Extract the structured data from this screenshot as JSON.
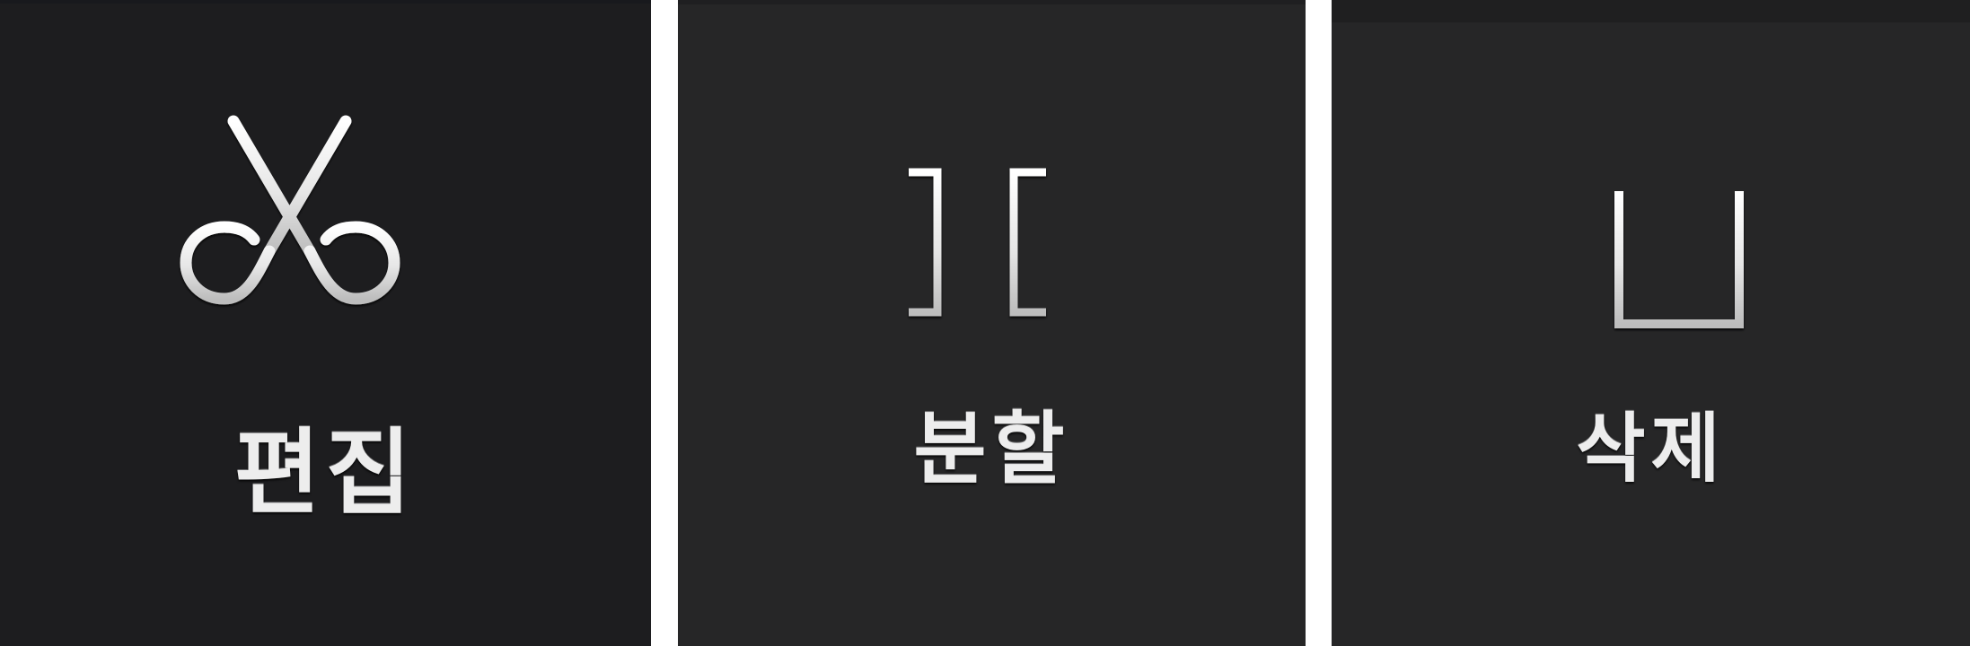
{
  "toolbar": {
    "items": [
      {
        "label": "편집",
        "icon": "scissors-icon"
      },
      {
        "label": "분할",
        "icon": "split-brackets-icon"
      },
      {
        "label": "삭제",
        "icon": "trash-can-icon"
      }
    ]
  },
  "colors": {
    "panel_background_edit": "#1d1d1f",
    "panel_background_split": "#262627",
    "panel_background_delete": "#262627",
    "icon_and_label": "#ededed",
    "separator": "#ffffff"
  }
}
